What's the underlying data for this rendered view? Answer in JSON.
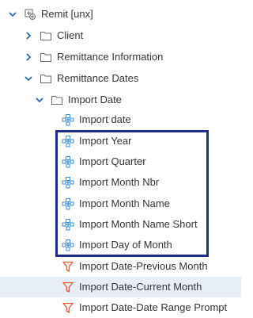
{
  "tree": {
    "root": {
      "label": "Remit [unx]",
      "icon": "universe-icon",
      "expanded": true
    },
    "nodes": [
      {
        "label": "Client",
        "icon": "folder-icon",
        "expanded": false
      },
      {
        "label": "Remittance Information",
        "icon": "folder-icon",
        "expanded": false
      },
      {
        "label": "Remittance Dates",
        "icon": "folder-icon",
        "expanded": true
      },
      {
        "label": "Import Date",
        "icon": "folder-icon",
        "expanded": true
      }
    ],
    "dimensions": [
      {
        "label": "Import date",
        "icon": "dimension-icon"
      },
      {
        "label": "Import Year",
        "icon": "dimension-icon"
      },
      {
        "label": "Import Quarter",
        "icon": "dimension-icon"
      },
      {
        "label": "Import Month Nbr",
        "icon": "dimension-icon"
      },
      {
        "label": "Import Month Name",
        "icon": "dimension-icon"
      },
      {
        "label": "Import Month Name Short",
        "icon": "dimension-icon"
      },
      {
        "label": "Import Day of Month",
        "icon": "dimension-icon"
      }
    ],
    "filters": [
      {
        "label": "Import Date-Previous Month",
        "icon": "filter-icon"
      },
      {
        "label": "Import Date-Current Month",
        "icon": "filter-icon",
        "selected": true
      },
      {
        "label": "Import Date-Date Range Prompt",
        "icon": "filter-icon"
      }
    ]
  },
  "colors": {
    "dimension_icon": "#3b8fd6",
    "filter_icon": "#e8562f",
    "highlight_border": "#1f2f8c",
    "selected_row": "#e8eef7",
    "chevron": "#1d5fa8"
  }
}
